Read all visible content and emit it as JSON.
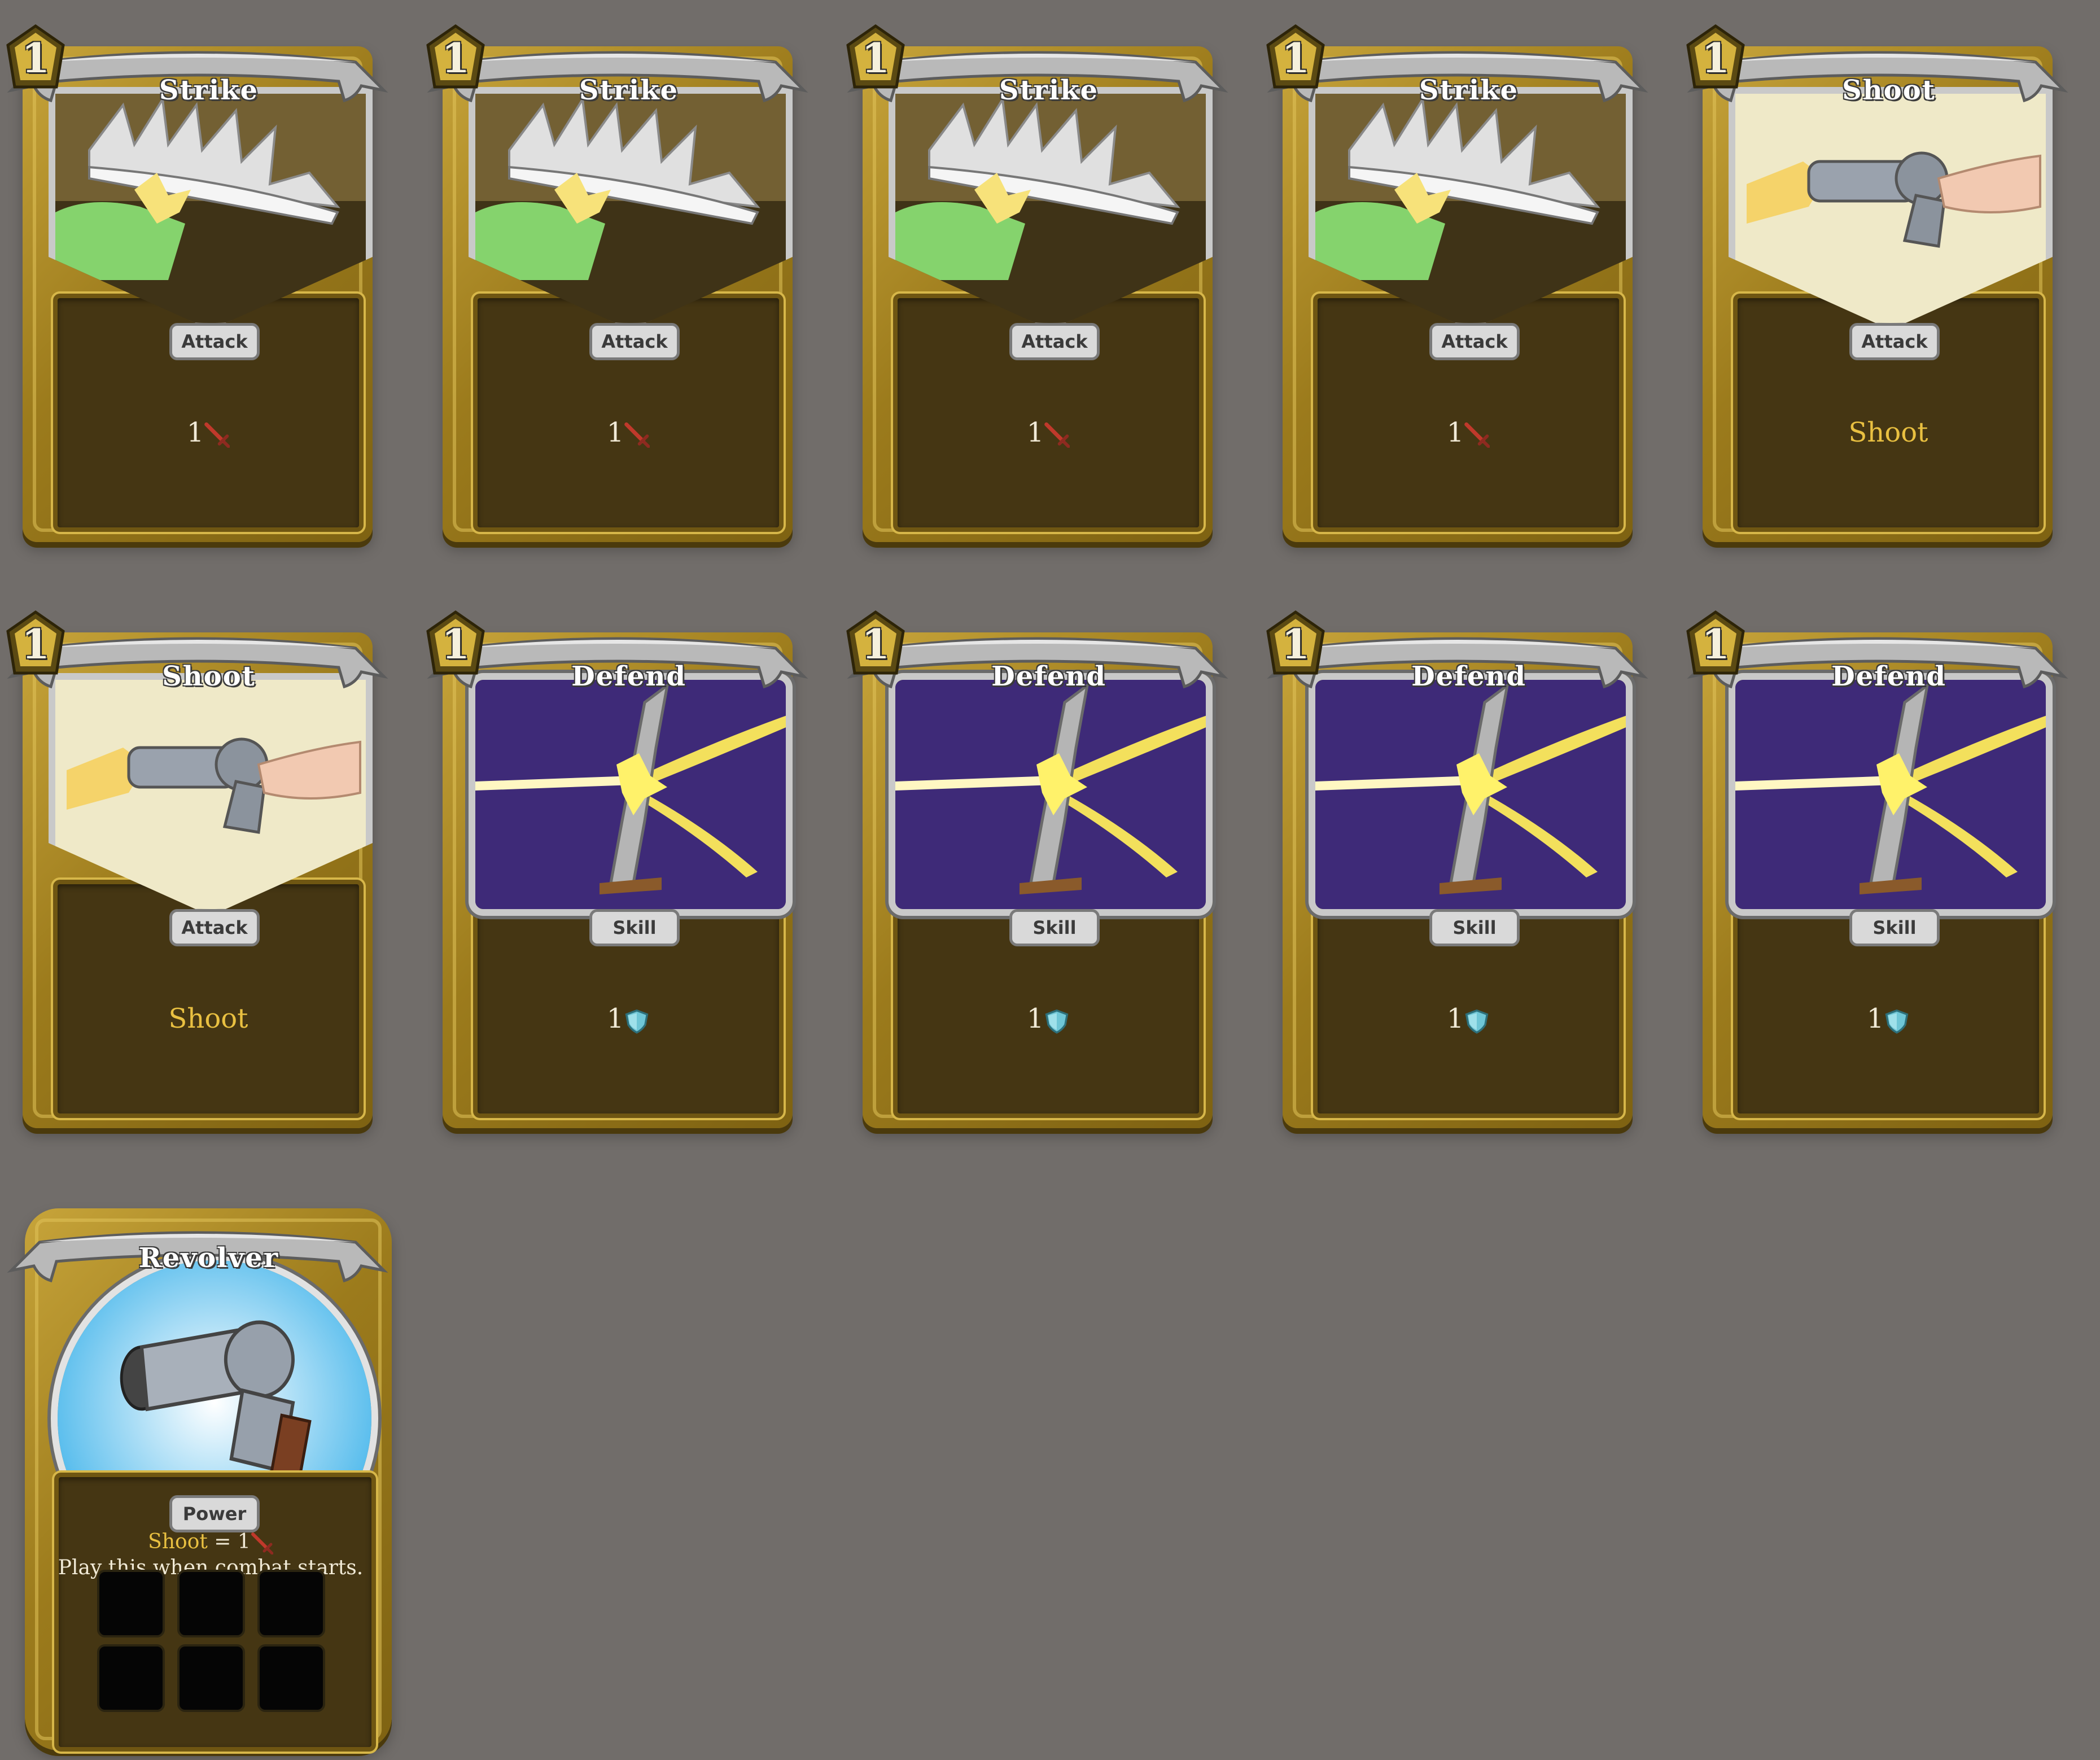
{
  "cards": [
    {
      "cost": "1",
      "title": "Strike",
      "type": "Attack",
      "art": "sword-slash",
      "amount": "1",
      "icon": "sword-icon"
    },
    {
      "cost": "1",
      "title": "Strike",
      "type": "Attack",
      "art": "sword-slash",
      "amount": "1",
      "icon": "sword-icon"
    },
    {
      "cost": "1",
      "title": "Strike",
      "type": "Attack",
      "art": "sword-slash",
      "amount": "1",
      "icon": "sword-icon"
    },
    {
      "cost": "1",
      "title": "Strike",
      "type": "Attack",
      "art": "sword-slash",
      "amount": "1",
      "icon": "sword-icon"
    },
    {
      "cost": "1",
      "title": "Shoot",
      "type": "Attack",
      "art": "revolver-firing",
      "keyword": "Shoot"
    },
    {
      "cost": "1",
      "title": "Shoot",
      "type": "Attack",
      "art": "revolver-firing",
      "keyword": "Shoot"
    },
    {
      "cost": "1",
      "title": "Defend",
      "type": "Skill",
      "art": "sword-deflect",
      "amount": "1",
      "icon": "shield-icon"
    },
    {
      "cost": "1",
      "title": "Defend",
      "type": "Skill",
      "art": "sword-deflect",
      "amount": "1",
      "icon": "shield-icon"
    },
    {
      "cost": "1",
      "title": "Defend",
      "type": "Skill",
      "art": "sword-deflect",
      "amount": "1",
      "icon": "shield-icon"
    },
    {
      "cost": "1",
      "title": "Defend",
      "type": "Skill",
      "art": "sword-deflect",
      "amount": "1",
      "icon": "shield-icon"
    }
  ],
  "power_card": {
    "title": "Revolver",
    "type": "Power",
    "art": "revolver",
    "keyword": "Shoot",
    "equals": " = 1",
    "icon": "sword-icon",
    "text": "Play this when combat starts.",
    "slots": 6
  },
  "colors": {
    "background": "#716d6a",
    "card_gold": "#9c7b1c",
    "panel": "#453613",
    "keyword": "#e9c041",
    "skill_art": "#3e2a78",
    "power_art": "#6cc7f2"
  }
}
